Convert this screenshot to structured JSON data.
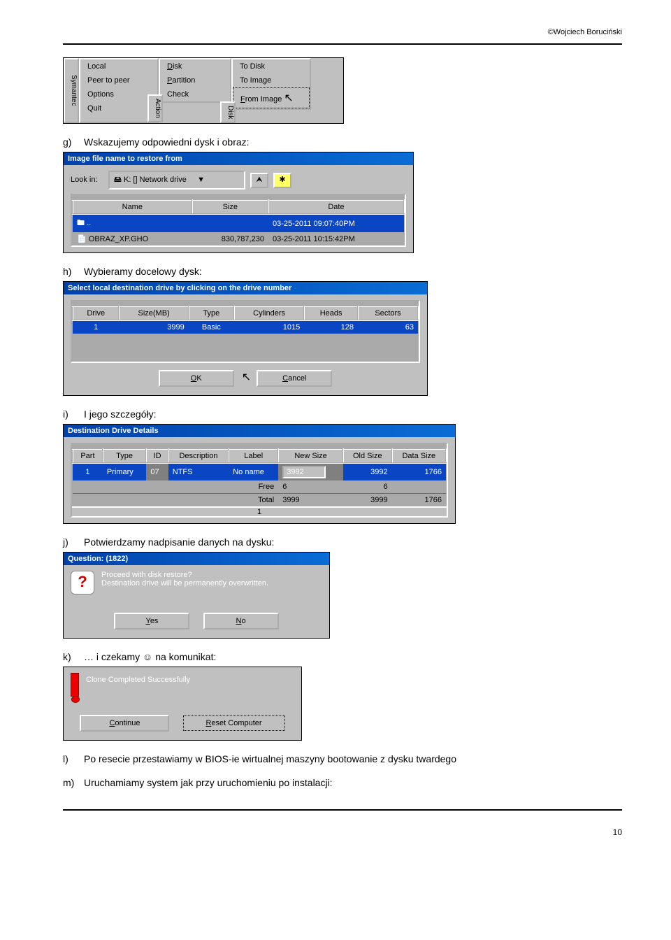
{
  "copyright": "©Wojciech Boruciński",
  "pagenum": "10",
  "items": {
    "g": {
      "letter": "g)",
      "text": "Wskazujemy odpowiedni dysk i obraz:"
    },
    "h": {
      "letter": "h)",
      "text": "Wybieramy docelowy dysk:"
    },
    "i": {
      "letter": "i)",
      "text": "I jego szczegóły:"
    },
    "j": {
      "letter": "j)",
      "text": "Potwierdzamy nadpisanie danych na dysku:"
    },
    "k": {
      "letter": "k)",
      "text": "… i czekamy ☺ na komunikat:"
    },
    "l": {
      "letter": "l)",
      "text": "Po resecie przestawiamy w BIOS-ie wirtualnej maszyny bootowanie z dysku twardego"
    },
    "m": {
      "letter": "m)",
      "text": "Uruchamiamy system jak przy uruchomieniu po instalacji:"
    }
  },
  "menu1": {
    "symantec": "Symantec",
    "col1": [
      "Local",
      "Peer to peer",
      "Options",
      "Quit"
    ],
    "col2_label": "Action",
    "col2": [
      "Disk",
      "Partition",
      "Check"
    ],
    "col3_label": "Disk",
    "col3": [
      "To Disk",
      "To Image",
      "From Image"
    ]
  },
  "dlg_file": {
    "title": "Image file name to restore from",
    "lookin": "Look in:",
    "drive": "K: [] Network drive",
    "headers": [
      "Name",
      "Size",
      "Date"
    ],
    "rows": [
      {
        "name": "..",
        "size": "",
        "date": "03-25-2011 09:07:40PM",
        "sel": true
      },
      {
        "name": "OBRAZ_XP.GHO",
        "size": "830,787,230",
        "date": "03-25-2011 10:15:42PM",
        "sel": false
      }
    ]
  },
  "dlg_dest": {
    "title": "Select local destination drive by clicking on the drive number",
    "headers": [
      "Drive",
      "Size(MB)",
      "Type",
      "Cylinders",
      "Heads",
      "Sectors"
    ],
    "row": [
      "1",
      "3999",
      "Basic",
      "1015",
      "128",
      "63"
    ],
    "ok": "OK",
    "cancel": "Cancel"
  },
  "dlg_det": {
    "title": "Destination Drive Details",
    "headers": [
      "Part",
      "Type",
      "ID",
      "Description",
      "Label",
      "New Size",
      "Old Size",
      "Data Size"
    ],
    "row": [
      "1",
      "Primary",
      "07",
      "NTFS",
      "No name",
      "3992",
      "3992",
      "1766"
    ],
    "free_label": "Free",
    "free_new": "6",
    "free_old": "6",
    "total_label": "Total",
    "total_new": "3999",
    "total_old": "3999",
    "total_data": "1766",
    "footer": "1"
  },
  "dlg_q": {
    "title": "Question: (1822)",
    "line1": "Proceed with disk restore?",
    "line2": "Destination drive will be permanently overwritten.",
    "yes": "Yes",
    "no": "No"
  },
  "dlg_done": {
    "msg": "Clone Completed Successfully",
    "cont": "Continue",
    "reset": "Reset Computer"
  }
}
